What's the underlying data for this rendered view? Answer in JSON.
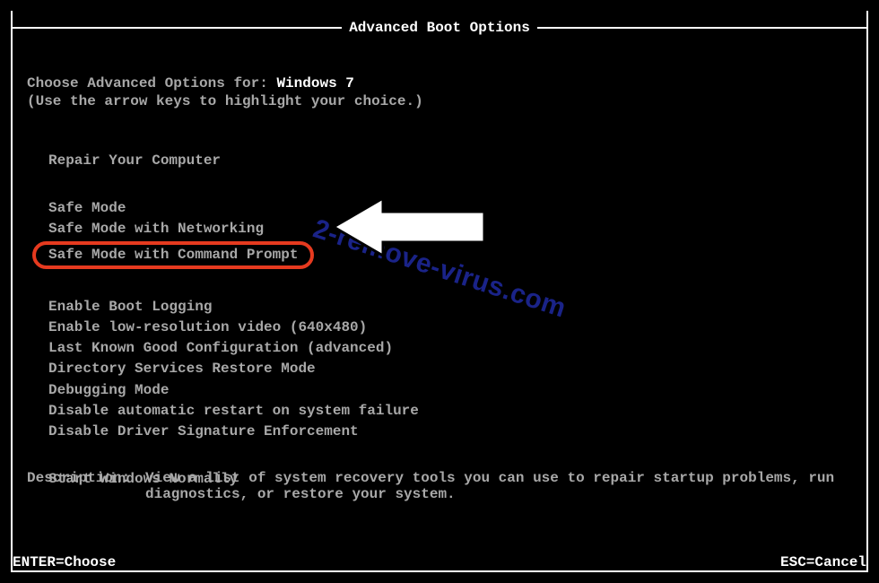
{
  "title": "Advanced Boot Options",
  "choose_label": "Choose Advanced Options for: ",
  "os_name": "Windows 7",
  "instruction": "(Use the arrow keys to highlight your choice.)",
  "groups": [
    {
      "items": [
        {
          "label": "Repair Your Computer"
        }
      ]
    },
    {
      "items": [
        {
          "label": "Safe Mode"
        },
        {
          "label": "Safe Mode with Networking"
        },
        {
          "label": "Safe Mode with Command Prompt",
          "selected": true
        }
      ]
    },
    {
      "items": [
        {
          "label": "Enable Boot Logging"
        },
        {
          "label": "Enable low-resolution video (640x480)"
        },
        {
          "label": "Last Known Good Configuration (advanced)"
        },
        {
          "label": "Directory Services Restore Mode"
        },
        {
          "label": "Debugging Mode"
        },
        {
          "label": "Disable automatic restart on system failure"
        },
        {
          "label": "Disable Driver Signature Enforcement"
        }
      ]
    },
    {
      "items": [
        {
          "label": "Start Windows Normally"
        }
      ]
    }
  ],
  "description_label": "Description:",
  "description_text": "View a list of system recovery tools you can use to repair startup problems, run diagnostics, or restore your system.",
  "footer": {
    "enter": "ENTER=Choose",
    "esc": "ESC=Cancel"
  },
  "watermark": "2-remove-virus.com",
  "colors": {
    "highlight_border": "#e63a1f",
    "watermark": "#1f2aa0",
    "fg": "#a8a8a8",
    "bg": "#000000",
    "bright": "#ffffff"
  }
}
